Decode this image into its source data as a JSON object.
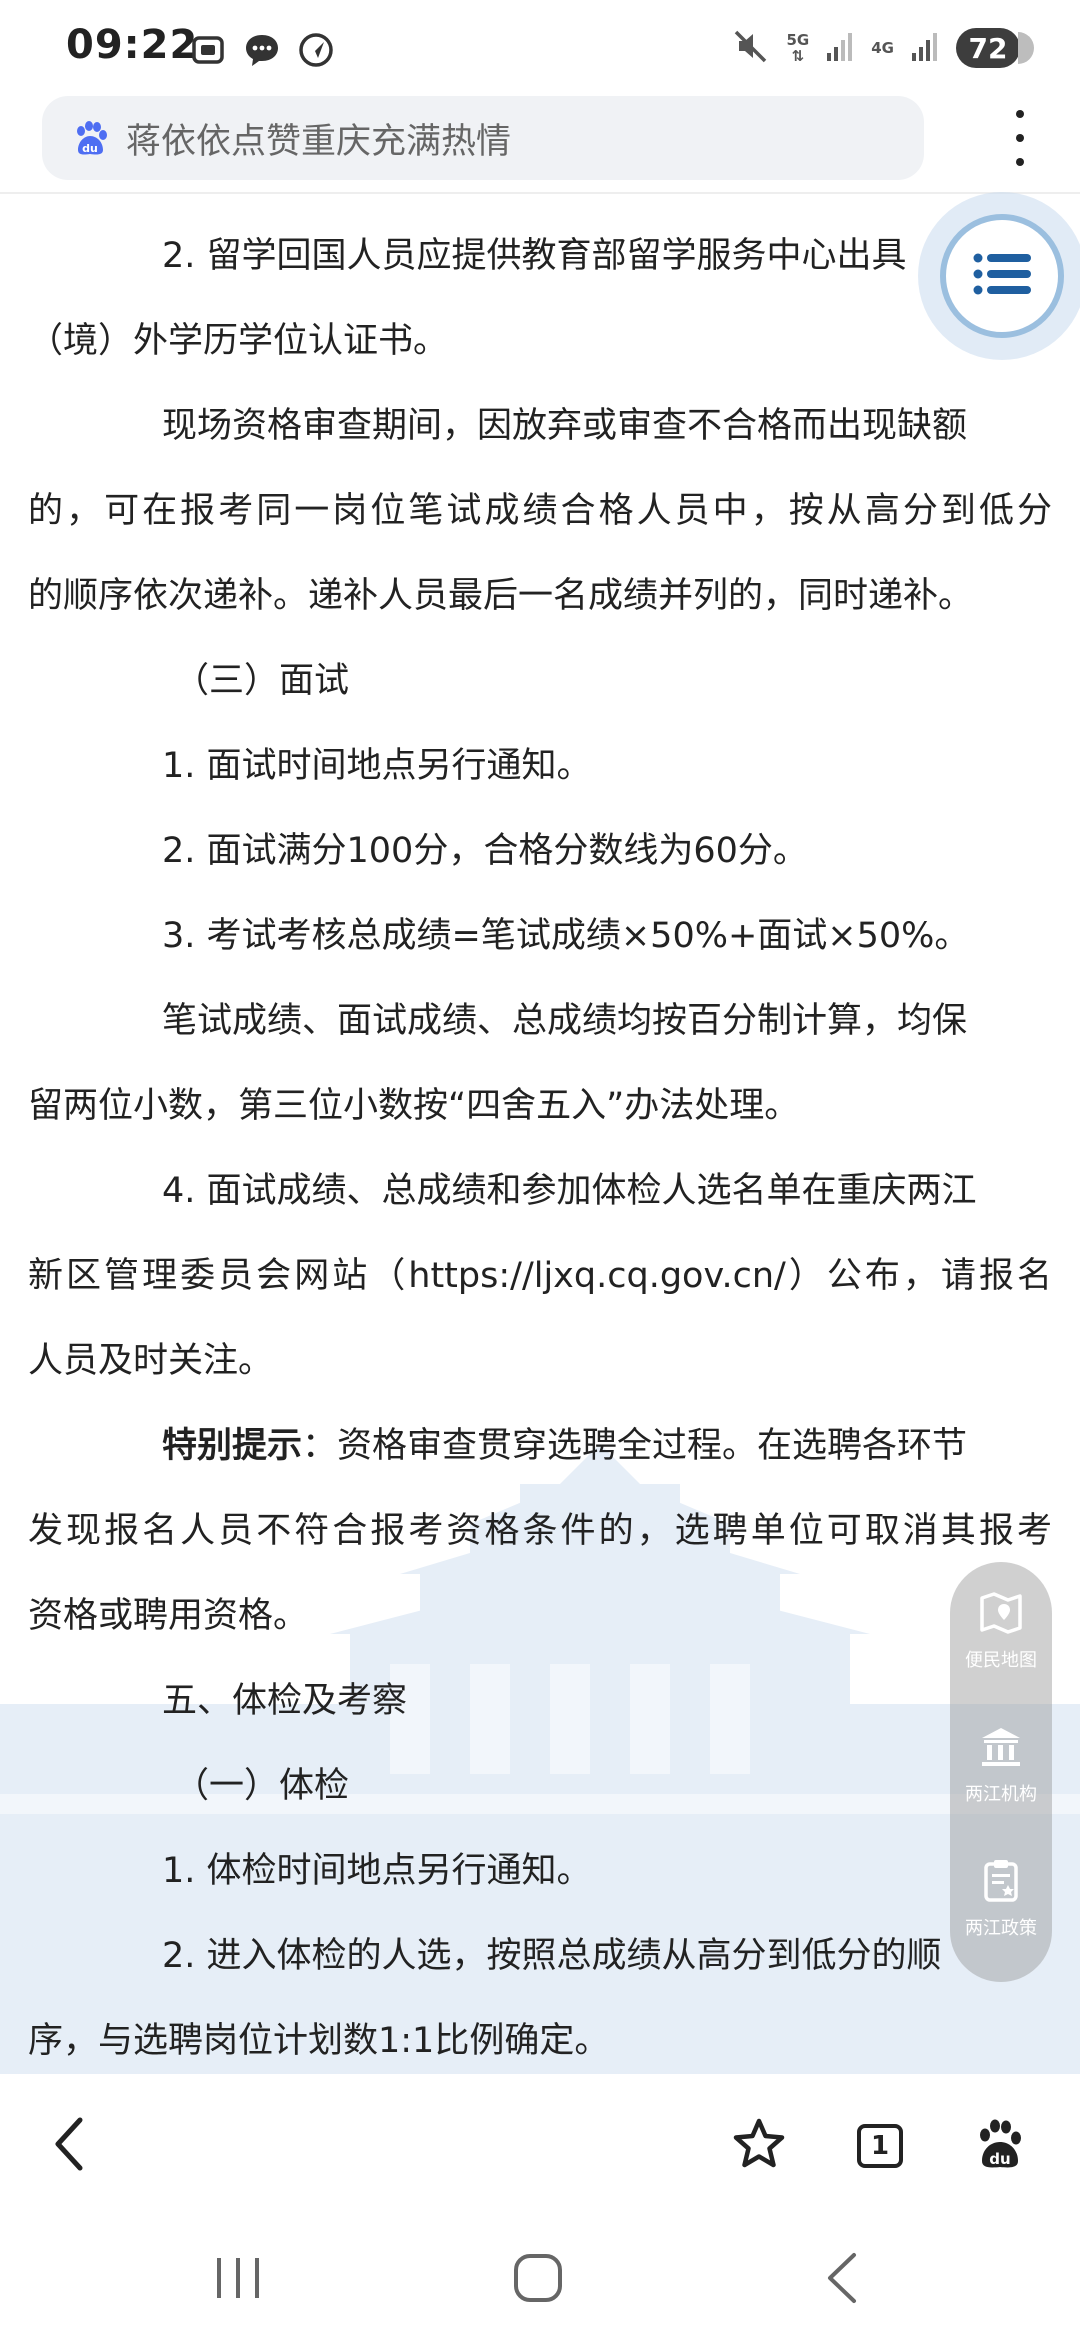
{
  "status_bar": {
    "time": "09:22",
    "network_5g": "5G",
    "network_4g": "4G",
    "battery": "72"
  },
  "address_bar": {
    "search_text": "蒋依依点赞重庆充满热情"
  },
  "article": {
    "l1": "2. 留学回国人员应提供教育部留学服务中心出具",
    "l2": "（境）外学历学位认证书。",
    "l3": "现场资格审查期间，因放弃或审查不合格而出现缺额",
    "l4": "的，可在报考同一岗位笔试成绩合格人员中，按从高分到低分",
    "l5": "的顺序依次递补。递补人员最后一名成绩并列的，同时递补。",
    "l6": "（三）面试",
    "l7": "1. 面试时间地点另行通知。",
    "l8": "2. 面试满分100分，合格分数线为60分。",
    "l9": "3. 考试考核总成绩=笔试成绩×50%+面试×50%。",
    "l10": "笔试成绩、面试成绩、总成绩均按百分制计算，均保",
    "l11": "留两位小数，第三位小数按“四舍五入”办法处理。",
    "l12": "4. 面试成绩、总成绩和参加体检人选名单在重庆两江",
    "l13": "新区管理委员会网站（https://ljxq.cq.gov.cn/）公布，请报名",
    "l14": "人员及时关注。",
    "l15_bold": "特别提示",
    "l15_rest": "：资格审查贯穿选聘全过程。在选聘各环节",
    "l16": "发现报名人员不符合报考资格条件的，选聘单位可取消其报考",
    "l17": "资格或聘用资格。",
    "l18": "五、体检及考察",
    "l19": "（一）体检",
    "l20": "1. 体检时间地点另行通知。",
    "l21": "2. 进入体检的人选，按照总成绩从高分到低分的顺",
    "l22": "序，与选聘岗位计划数1:1比例确定。"
  },
  "side_panel": {
    "items": [
      {
        "label": "便民地图",
        "icon": "map-icon"
      },
      {
        "label": "两江机构",
        "icon": "institution-icon"
      },
      {
        "label": "两江政策",
        "icon": "policy-icon"
      }
    ]
  },
  "toolbar": {
    "tab_count": "1"
  },
  "colors": {
    "toc_ring": "#9bbfdf",
    "toc_icon": "#1f5fa0",
    "skyline": "#e3ecf6"
  }
}
